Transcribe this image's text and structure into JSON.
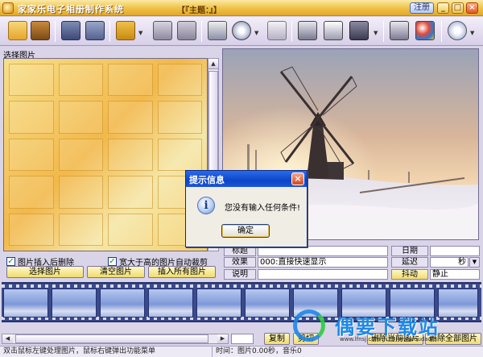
{
  "window": {
    "title": "家家乐电子相册制作系统",
    "theme": "【『主题：』】",
    "register_label": "注册"
  },
  "toolbar": {
    "buttons": [
      "new-album",
      "open-album",
      "save-album",
      "save-all",
      "insert-frame",
      "print",
      "delete",
      "edit-text",
      "disc",
      "music",
      "theme-book",
      "export",
      "screenshot",
      "brush",
      "palette",
      "settings"
    ]
  },
  "left_panel": {
    "label": "选择图片",
    "options": {
      "delete_after_insert": {
        "label": "图片插入后删除",
        "checked": true
      },
      "auto_crop_wide": {
        "label": "宽大于高的图片自动裁剪",
        "checked": true
      }
    },
    "buttons": {
      "select": "选择图片",
      "clear": "清空图片",
      "insert_all": "插入所有图片"
    }
  },
  "properties": {
    "title_label": "标题",
    "title_value": "",
    "effect_label": "效果",
    "effect_value": "000:直接快速显示",
    "desc_label": "说明",
    "desc_value": "",
    "date_label": "日期",
    "date_value": "",
    "delay_label": "延迟",
    "delay_unit": "秒",
    "shake_label": "抖动",
    "shake_value": "静止"
  },
  "bottom_buttons": {
    "copy": "复制",
    "cut": "剪切",
    "delete_current": "删除当前图片",
    "delete_all": "删除全部图片"
  },
  "status": {
    "hint": "双击鼠标左键处理图片，鼠标右键弹出功能菜单",
    "time": "时间：图片0.00秒，音乐0"
  },
  "watermark": {
    "text": "偶要下载站",
    "url": "www.lfnsj.com | 让别 www.oudaole"
  },
  "dialog": {
    "title": "提示信息",
    "message": "您没有输入任何条件!",
    "ok_label": "确定"
  }
}
